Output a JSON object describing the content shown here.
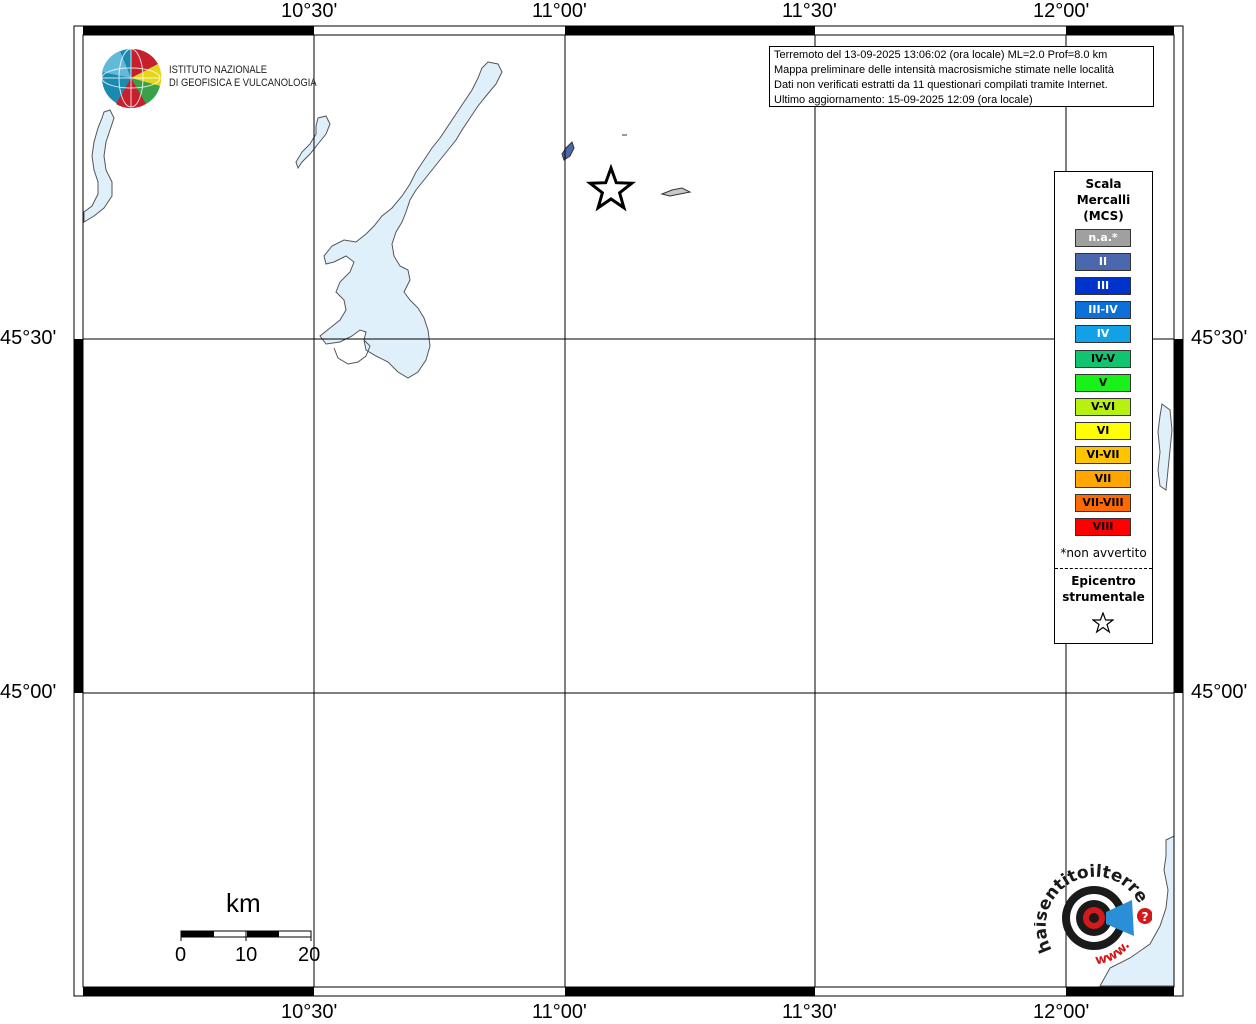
{
  "map": {
    "lon_labels_top": [
      "10°30'",
      "11°00'",
      "11°30'",
      "12°00'"
    ],
    "lon_labels_bottom": [
      "10°30'",
      "11°00'",
      "11°30'",
      "12°00'"
    ],
    "lat_labels_left": [
      "45°30'",
      "45°00'"
    ],
    "lat_labels_right": [
      "45°30'",
      "45°00'"
    ],
    "water_color": "#e0f0fb",
    "grid_color": "#000000"
  },
  "institute": {
    "line1": "ISTITUTO NAZIONALE",
    "line2": "DI GEOFISICA E VULCANOLOGIA"
  },
  "info": {
    "line1": "Terremoto del 13-09-2025 13:06:02 (ora locale) ML=2.0 Prof=8.0 km",
    "line2": "Mappa preliminare delle intensità macrosismiche stimate nelle località",
    "line3": "Dati non verificati estratti da 11 questionari compilati tramite Internet.",
    "line4": "Ultimo aggiornamento: 15-09-2025 12:09 (ora locale)"
  },
  "legend": {
    "title1": "Scala",
    "title2": "Mercalli",
    "title3": "(MCS)",
    "items": [
      {
        "label": "n.a.*",
        "color": "#a0a0a0",
        "text": "#ffffff"
      },
      {
        "label": "II",
        "color": "#4b67ad",
        "text": "#ffffff"
      },
      {
        "label": "III",
        "color": "#0033cc",
        "text": "#ffffff"
      },
      {
        "label": "III-IV",
        "color": "#0d6fd8",
        "text": "#ffffff"
      },
      {
        "label": "IV",
        "color": "#12a0e6",
        "text": "#ffffff"
      },
      {
        "label": "IV-V",
        "color": "#12c36f",
        "text": "#000000"
      },
      {
        "label": "V",
        "color": "#1af01a",
        "text": "#000000"
      },
      {
        "label": "V-VI",
        "color": "#b7f10f",
        "text": "#000000"
      },
      {
        "label": "VI",
        "color": "#ffff00",
        "text": "#000000"
      },
      {
        "label": "VI-VII",
        "color": "#ffc400",
        "text": "#000000"
      },
      {
        "label": "VII",
        "color": "#ffa500",
        "text": "#000000"
      },
      {
        "label": "VII-VIII",
        "color": "#ff6a00",
        "text": "#000000"
      },
      {
        "label": "VIII",
        "color": "#ff0000",
        "text": "#000000"
      }
    ],
    "note": "*non avvertito",
    "epicentre1": "Epicentro",
    "epicentre2": "strumentale"
  },
  "scale": {
    "unit": "km",
    "labels": [
      "0",
      "10",
      "20"
    ]
  },
  "hst_logo": {
    "text_top": "haisentitoilterremoto.it",
    "text_bottom": "www.",
    "question": "?"
  }
}
